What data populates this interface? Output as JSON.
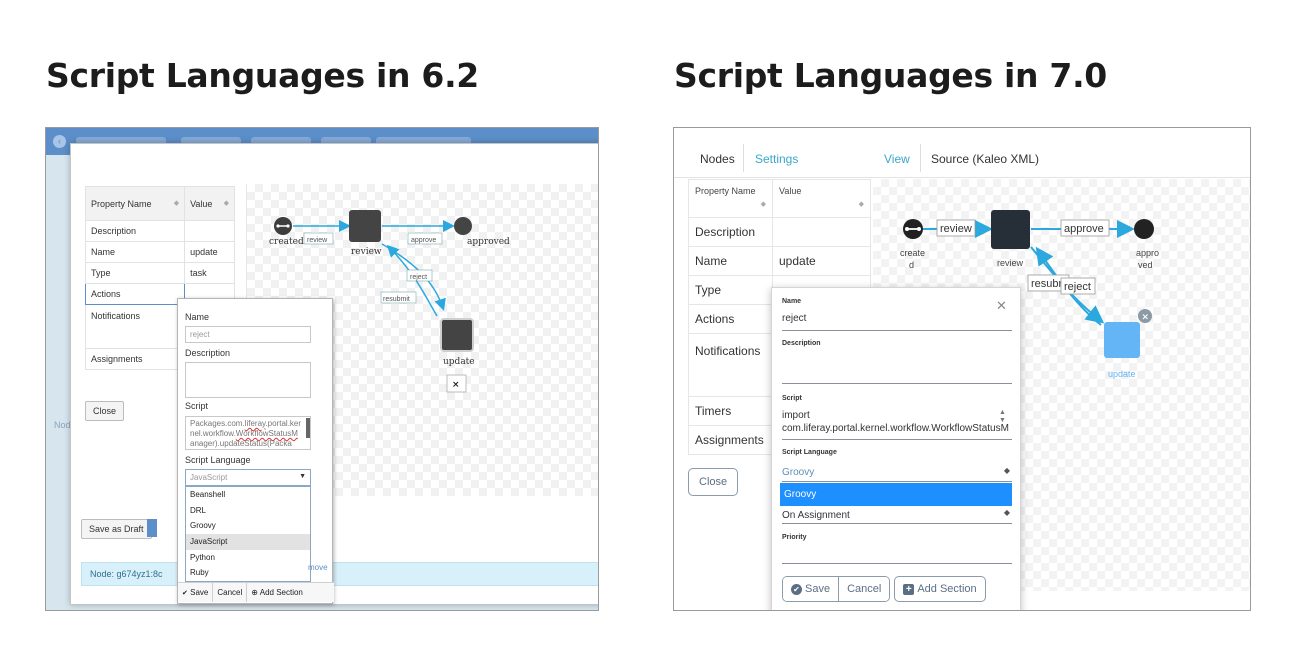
{
  "titles": {
    "left": "Script Languages in 6.2",
    "right": "Script Languages in 7.0"
  },
  "v62": {
    "table": {
      "col_name": "Property Name",
      "col_value": "Value",
      "rows": [
        {
          "name": "Description",
          "value": ""
        },
        {
          "name": "Name",
          "value": "update"
        },
        {
          "name": "Type",
          "value": "task"
        },
        {
          "name": "Actions",
          "value": ""
        },
        {
          "name": "Notifications",
          "value": ""
        },
        {
          "name": "Assignments",
          "value": ""
        }
      ]
    },
    "close_label": "Close",
    "save_draft_label": "Save as Draft",
    "status_text": "Node: g674yz1:8c",
    "side_label": "Node",
    "canvas": {
      "nodes": {
        "created": "created",
        "review": "review",
        "approved": "approved",
        "update": "update"
      },
      "transitions": {
        "review": "review",
        "approve": "approve",
        "reject": "reject",
        "resubmit": "resubmit"
      }
    },
    "popup": {
      "name_label": "Name",
      "name_value": "reject",
      "description_label": "Description",
      "script_label": "Script",
      "script_text_1": "Packages.com.",
      "script_text_1_sq": "liferay",
      "script_text_1_end": ".portal.ker",
      "script_text_2": "nel.workflow.",
      "script_text_2_sq": "WorkflowStatusM",
      "script_text_3": "anager).updateStatus(Packa",
      "script_language_label": "Script Language",
      "selected": "JavaScript",
      "options": [
        "Beanshell",
        "DRL",
        "Groovy",
        "JavaScript",
        "Python",
        "Ruby"
      ],
      "remove_link": "move",
      "save_label": "Save",
      "cancel_label": "Cancel",
      "add_section_label": "Add Section"
    }
  },
  "v70": {
    "tabs": {
      "nodes": "Nodes",
      "settings": "Settings",
      "view": "View",
      "source": "Source (Kaleo XML)"
    },
    "table": {
      "col_name": "Property Name",
      "col_value": "Value",
      "rows": [
        {
          "name": "Description",
          "value": ""
        },
        {
          "name": "Name",
          "value": "update"
        },
        {
          "name": "Type",
          "value": ""
        },
        {
          "name": "Actions",
          "value": ""
        },
        {
          "name": "Notifications",
          "value": ""
        },
        {
          "name": "Timers",
          "value": ""
        },
        {
          "name": "Assignments",
          "value": ""
        }
      ]
    },
    "close_label": "Close",
    "canvas": {
      "nodes": {
        "created_1": "create",
        "created_2": "d",
        "review": "review",
        "approved_1": "appro",
        "approved_2": "ved",
        "update": "update"
      },
      "transitions": {
        "review": "review",
        "approve": "approve",
        "reject": "reject",
        "resubmit": "resubr"
      }
    },
    "popup": {
      "name_label": "Name",
      "name_value": "reject",
      "description_label": "Description",
      "script_label": "Script",
      "script_line_1": "import",
      "script_line_2": "com.liferay.portal.kernel.workflow.WorkflowStatusM",
      "script_language_label": "Script Language",
      "selected": "Groovy",
      "open_option": "Groovy",
      "execution": "On Assignment",
      "priority_label": "Priority",
      "save_label": "Save",
      "cancel_label": "Cancel",
      "add_section_label": "Add Section"
    },
    "accent": "#1e8fff"
  }
}
